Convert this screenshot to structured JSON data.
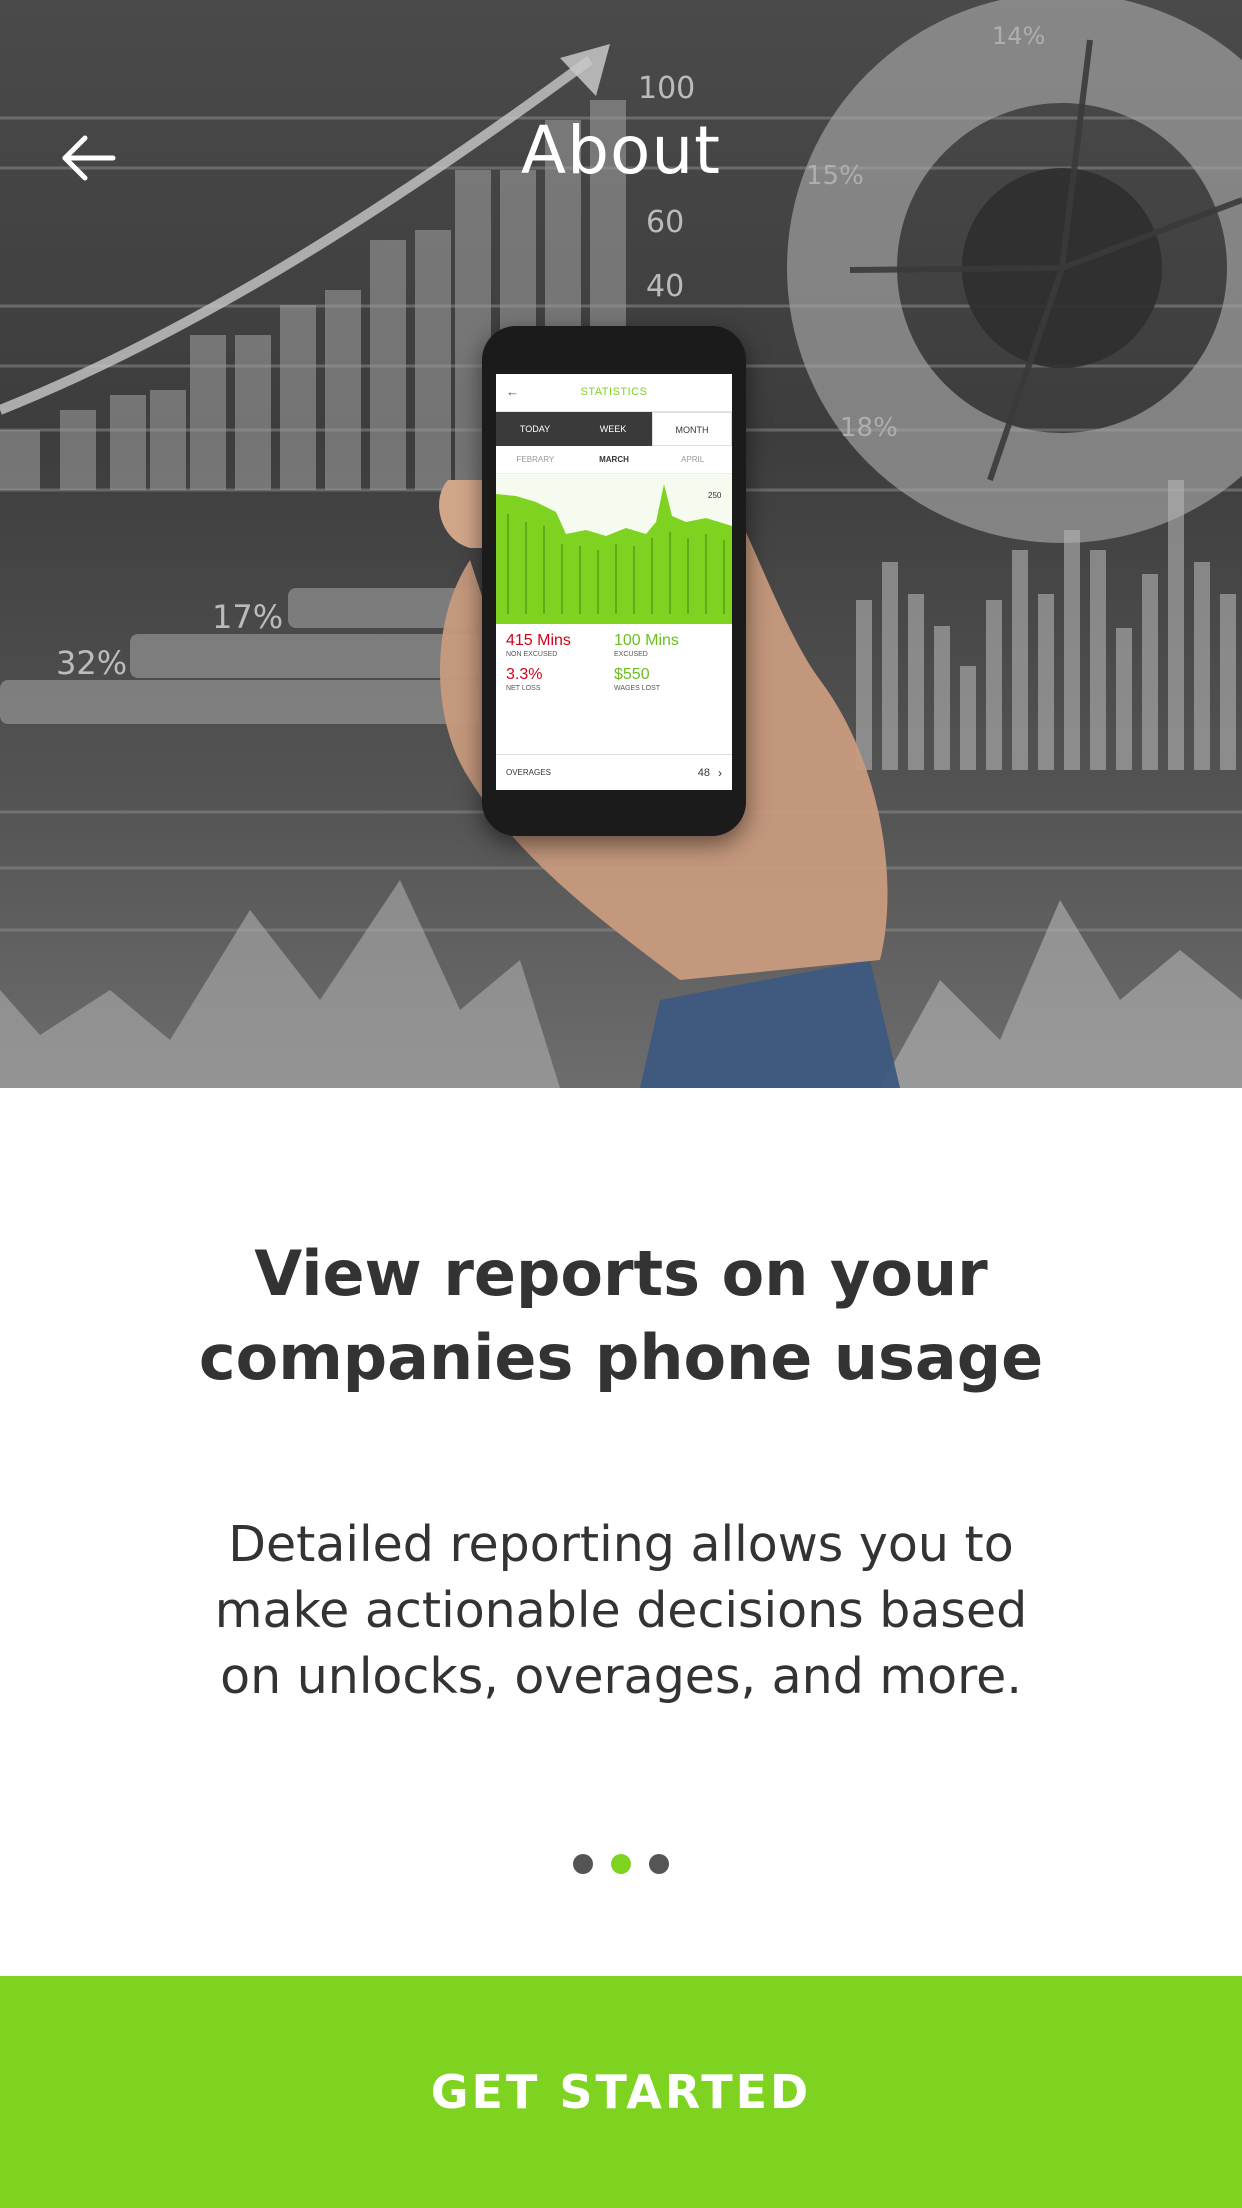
{
  "header": {
    "title": "About",
    "back_icon": "arrow-left-icon"
  },
  "hero": {
    "background_labels": {
      "axis_100": "100",
      "axis_60": "60",
      "axis_40": "40",
      "pie_14": "14%",
      "pie_15": "15%",
      "pie_18": "18%",
      "bar_17": "17%",
      "bar_32": "32%"
    },
    "phone": {
      "screen_title": "STATISTICS",
      "tabs": [
        {
          "label": "TODAY",
          "active": false
        },
        {
          "label": "WEEK",
          "active": false
        },
        {
          "label": "MONTH",
          "active": true
        }
      ],
      "months": [
        {
          "label": "FEBRARY",
          "active": false
        },
        {
          "label": "MARCH",
          "active": true
        },
        {
          "label": "APRIL",
          "active": false
        }
      ],
      "chart_peak_label": "250",
      "stats": [
        {
          "value": "415 Mins",
          "label": "NON EXCUSED",
          "color": "red"
        },
        {
          "value": "100 Mins",
          "label": "EXCUSED",
          "color": "green"
        },
        {
          "value": "3.3%",
          "label": "NET LOSS",
          "color": "red"
        },
        {
          "value": "$550",
          "label": "WAGES LOST",
          "color": "green"
        }
      ],
      "overages_label": "OVERAGES",
      "overages_value": "48"
    }
  },
  "content": {
    "headline": "View reports on your\ncompanies phone usage",
    "description": "Detailed reporting allows you to\nmake actionable decisions based\non unlocks, overages, and more."
  },
  "pager": {
    "total": 3,
    "active_index": 1
  },
  "cta": {
    "label": "GET STARTED"
  },
  "colors": {
    "accent": "#7ed321",
    "text": "#333333",
    "dot_inactive": "#555555"
  }
}
